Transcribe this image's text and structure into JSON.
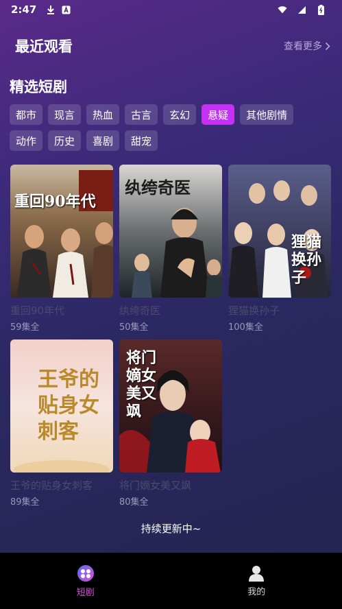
{
  "status_bar": {
    "time": "2:47"
  },
  "recent": {
    "title": "最近观看",
    "more_label": "查看更多"
  },
  "featured": {
    "title": "精选短剧",
    "categories_row1": [
      "都市",
      "现言",
      "热血",
      "古言",
      "玄幻",
      "悬疑",
      "其他剧情"
    ],
    "categories_row2": [
      "动作",
      "历史",
      "喜剧",
      "甜宠"
    ],
    "active_category": "悬疑",
    "posters": [
      {
        "title": "重回90年代",
        "episodes": "59集全",
        "poster_text": "重回90年代"
      },
      {
        "title": "纨绔奇医",
        "episodes": "50集全",
        "poster_text": "纨绔奇医"
      },
      {
        "title": "狸猫换孙子",
        "episodes": "100集全",
        "poster_text": "狸猫换孙子"
      },
      {
        "title": "王爷的贴身女刺客",
        "episodes": "89集全",
        "poster_text": "王爷的贴身女刺客"
      },
      {
        "title": "将门嫡女美又飒",
        "episodes": "80集全",
        "poster_text": "将门嫡女美又飒"
      }
    ]
  },
  "footer_note": "持续更新中~",
  "tabs": [
    {
      "label": "短剧",
      "icon": "drama-icon",
      "active": true
    },
    {
      "label": "我的",
      "icon": "profile-icon",
      "active": false
    }
  ],
  "colors": {
    "accent": "#c531f2",
    "tab_active": "#d94fd8"
  }
}
